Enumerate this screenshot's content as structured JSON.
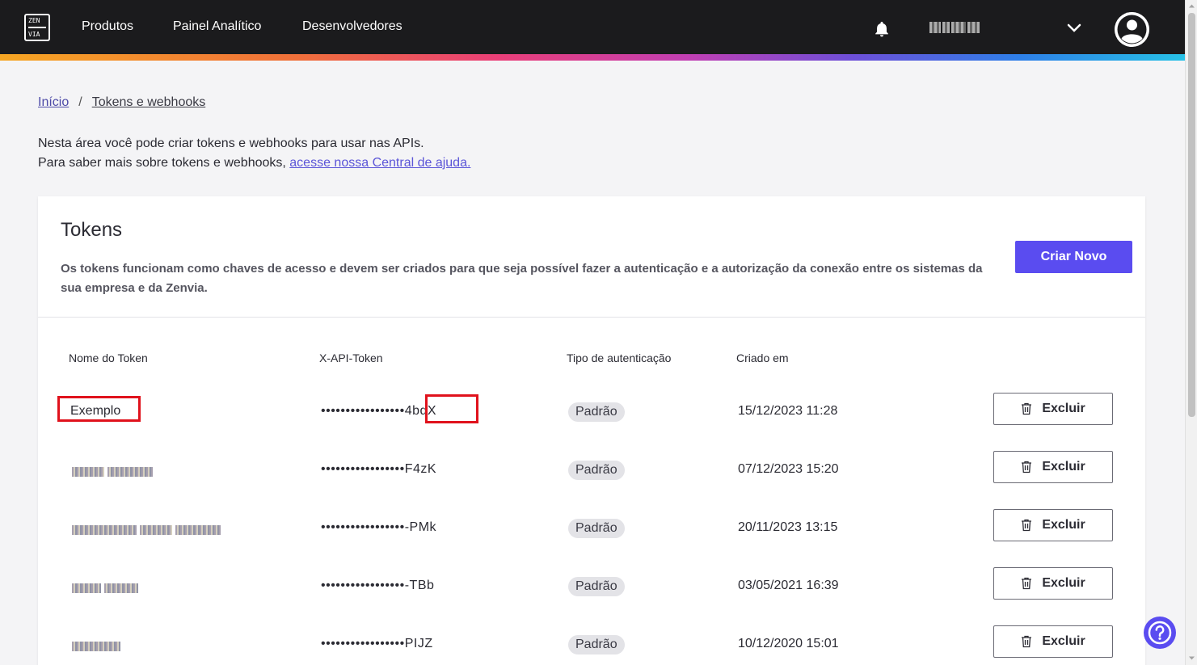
{
  "header": {
    "logo_top": "ZEN",
    "logo_bottom": "VIA",
    "nav": [
      "Produtos",
      "Painel Analítico",
      "Desenvolvedores"
    ]
  },
  "breadcrumb": {
    "home": "Início",
    "separator": "/",
    "current": "Tokens e webhooks"
  },
  "intro": {
    "line1": "Nesta área você pode criar tokens e webhooks para usar nas APIs.",
    "line2_prefix": "Para saber mais sobre tokens e webhooks, ",
    "line2_link": "acesse nossa Central de ajuda."
  },
  "tokens": {
    "title": "Tokens",
    "description": "Os tokens funcionam como chaves de acesso e devem ser criados para que seja possível fazer a autenticação e a autorização da conexão entre os sistemas da sua empresa e da Zenvia.",
    "create_button": "Criar Novo",
    "columns": [
      "Nome do Token",
      "X-API-Token",
      "Tipo de autenticação",
      "Criado em"
    ],
    "delete_label": "Excluir",
    "rows": [
      {
        "name": "Exemplo",
        "token": "•••••••••••••••••4bqX",
        "type": "Padrão",
        "created": "15/12/2023 11:28"
      },
      {
        "token": "•••••••••••••••••F4zK",
        "type": "Padrão",
        "created": "07/12/2023 15:20"
      },
      {
        "token": "•••••••••••••••••-PMk",
        "type": "Padrão",
        "created": "20/11/2023 13:15"
      },
      {
        "token": "•••••••••••••••••-TBb",
        "type": "Padrão",
        "created": "03/05/2021 16:39"
      },
      {
        "token": "•••••••••••••••••PIJZ",
        "type": "Padrão",
        "created": "10/12/2020 15:01"
      }
    ]
  },
  "colors": {
    "primary": "#5a4cf0",
    "header_bg": "#1b1b1d",
    "highlight": "#e0121c"
  }
}
